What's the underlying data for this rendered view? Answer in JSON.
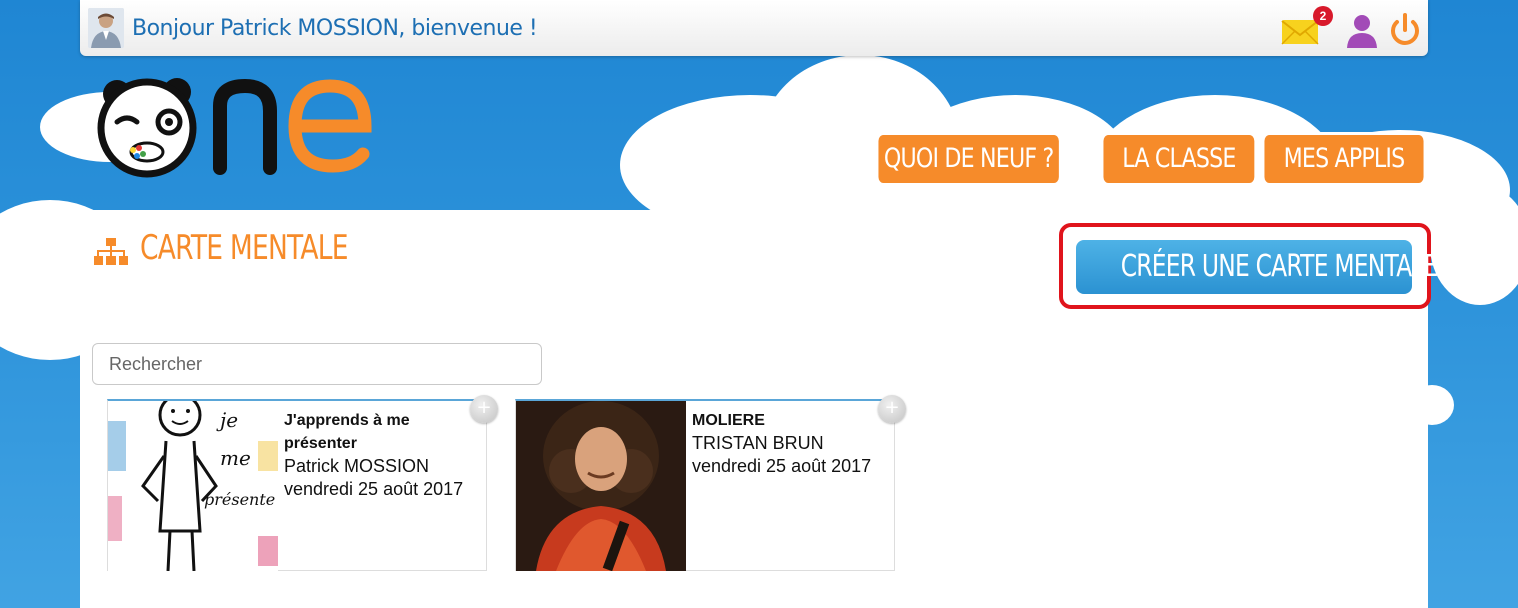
{
  "topbar": {
    "welcome": "Bonjour Patrick MOSSION, bienvenue !",
    "messages_count": "2",
    "icons": [
      "mail-icon",
      "user-profile-icon",
      "power-icon"
    ]
  },
  "logo": {
    "text": "one"
  },
  "nav": {
    "items": [
      {
        "label": "QUOI DE NEUF ?"
      },
      {
        "label": "LA CLASSE"
      },
      {
        "label": "MES APPLIS"
      }
    ]
  },
  "page": {
    "title": "CARTE MENTALE",
    "create_label": "CRÉER UNE CARTE MENTALE",
    "search_placeholder": "Rechercher"
  },
  "cards": [
    {
      "title": "J'apprends à me présenter",
      "author": "Patrick MOSSION",
      "date": "vendredi 25 août 2017",
      "thumb_words": [
        "je",
        "me",
        "présente"
      ]
    },
    {
      "title": "MOLIERE",
      "author": "TRISTAN BRUN",
      "date": "vendredi 25 août 2017"
    }
  ],
  "colors": {
    "sky": "#2c92da",
    "orange": "#f68b2a",
    "create_blue": "#2b92d2",
    "highlight_red": "#e0141c"
  }
}
